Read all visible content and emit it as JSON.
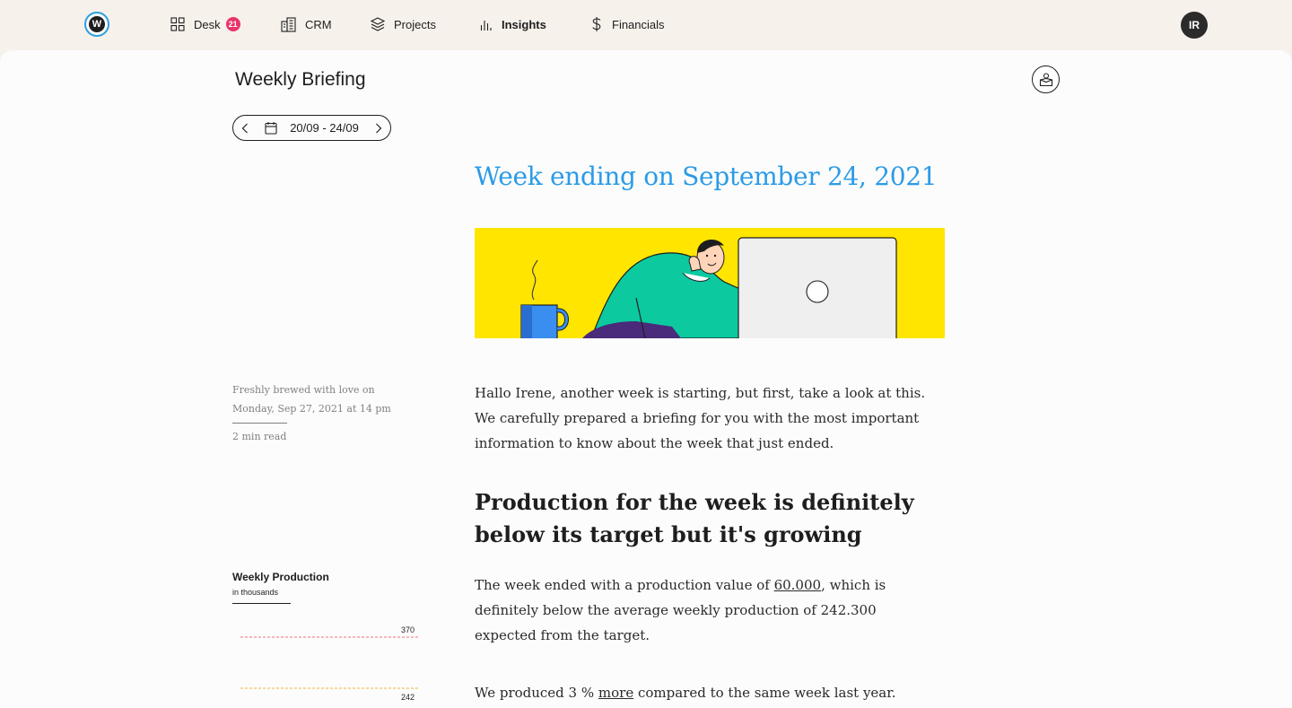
{
  "nav": {
    "logo_letter": "W",
    "items": [
      {
        "label": "Desk",
        "badge": "21"
      },
      {
        "label": "CRM"
      },
      {
        "label": "Projects"
      },
      {
        "label": "Insights",
        "active": true
      },
      {
        "label": "Financials"
      }
    ],
    "avatar_initials": "IR"
  },
  "page": {
    "title": "Weekly Briefing",
    "date_range": "20/09 - 24/09"
  },
  "briefing": {
    "heading": "Week ending on September 24, 2021",
    "meta_line1": "Freshly brewed with love on",
    "meta_line2": "Monday, Sep 27, 2021 at 14 pm",
    "read_time": "2 min read",
    "intro": "Hallo Irene, another week is starting, but first, take a look at this. We carefully prepared a briefing for you with the most important information to know about the week that just ended.",
    "section_heading": "Production for the week is definitely below its target but it's growing",
    "p1_before": "The week ended with a production value of ",
    "p1_value": "60.000",
    "p1_after": ", which is definitely below the average weekly production of 242.300 expected from the target.",
    "p2_before": "We produced 3 % ",
    "p2_link": "more",
    "p2_after": " compared to the same week last year."
  },
  "chart_data": {
    "type": "line",
    "title": "Weekly Production",
    "subtitle": "in thousands",
    "reference_lines": [
      {
        "value": 370,
        "label": "370",
        "color": "#ef6f7c"
      },
      {
        "value": 242,
        "label": "242",
        "color": "#f0b43c"
      }
    ]
  },
  "colors": {
    "accent": "#2b9be6",
    "badge": "#e8336b",
    "hero_bg": "#ffe500"
  }
}
